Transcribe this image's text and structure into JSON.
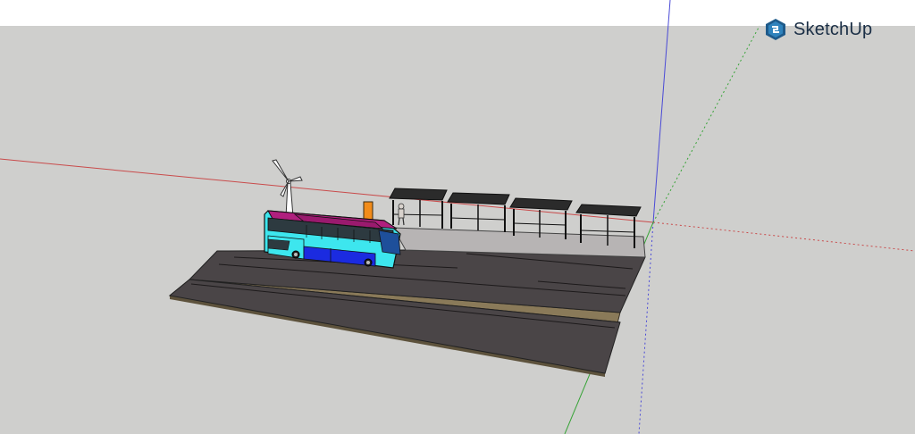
{
  "app": {
    "name": "SketchUp"
  },
  "colors": {
    "sky": "#ffffff",
    "ground": "#cfcfcd",
    "axis_red": "#c94b4b",
    "axis_green": "#36a336",
    "axis_blue": "#4a4ad6",
    "asphalt": "#4a4547",
    "soil": "#8a7a59",
    "sidewalk": "#b7b4b4",
    "bus_body": "#3de6ee",
    "bus_lower": "#1b2be0",
    "bus_roof": "#b0207e",
    "turbine": "#ffffff"
  },
  "scene": {
    "objects": [
      "road",
      "sidewalk",
      "bus",
      "wind-turbine",
      "bus-shelters",
      "person",
      "info-sign"
    ]
  }
}
